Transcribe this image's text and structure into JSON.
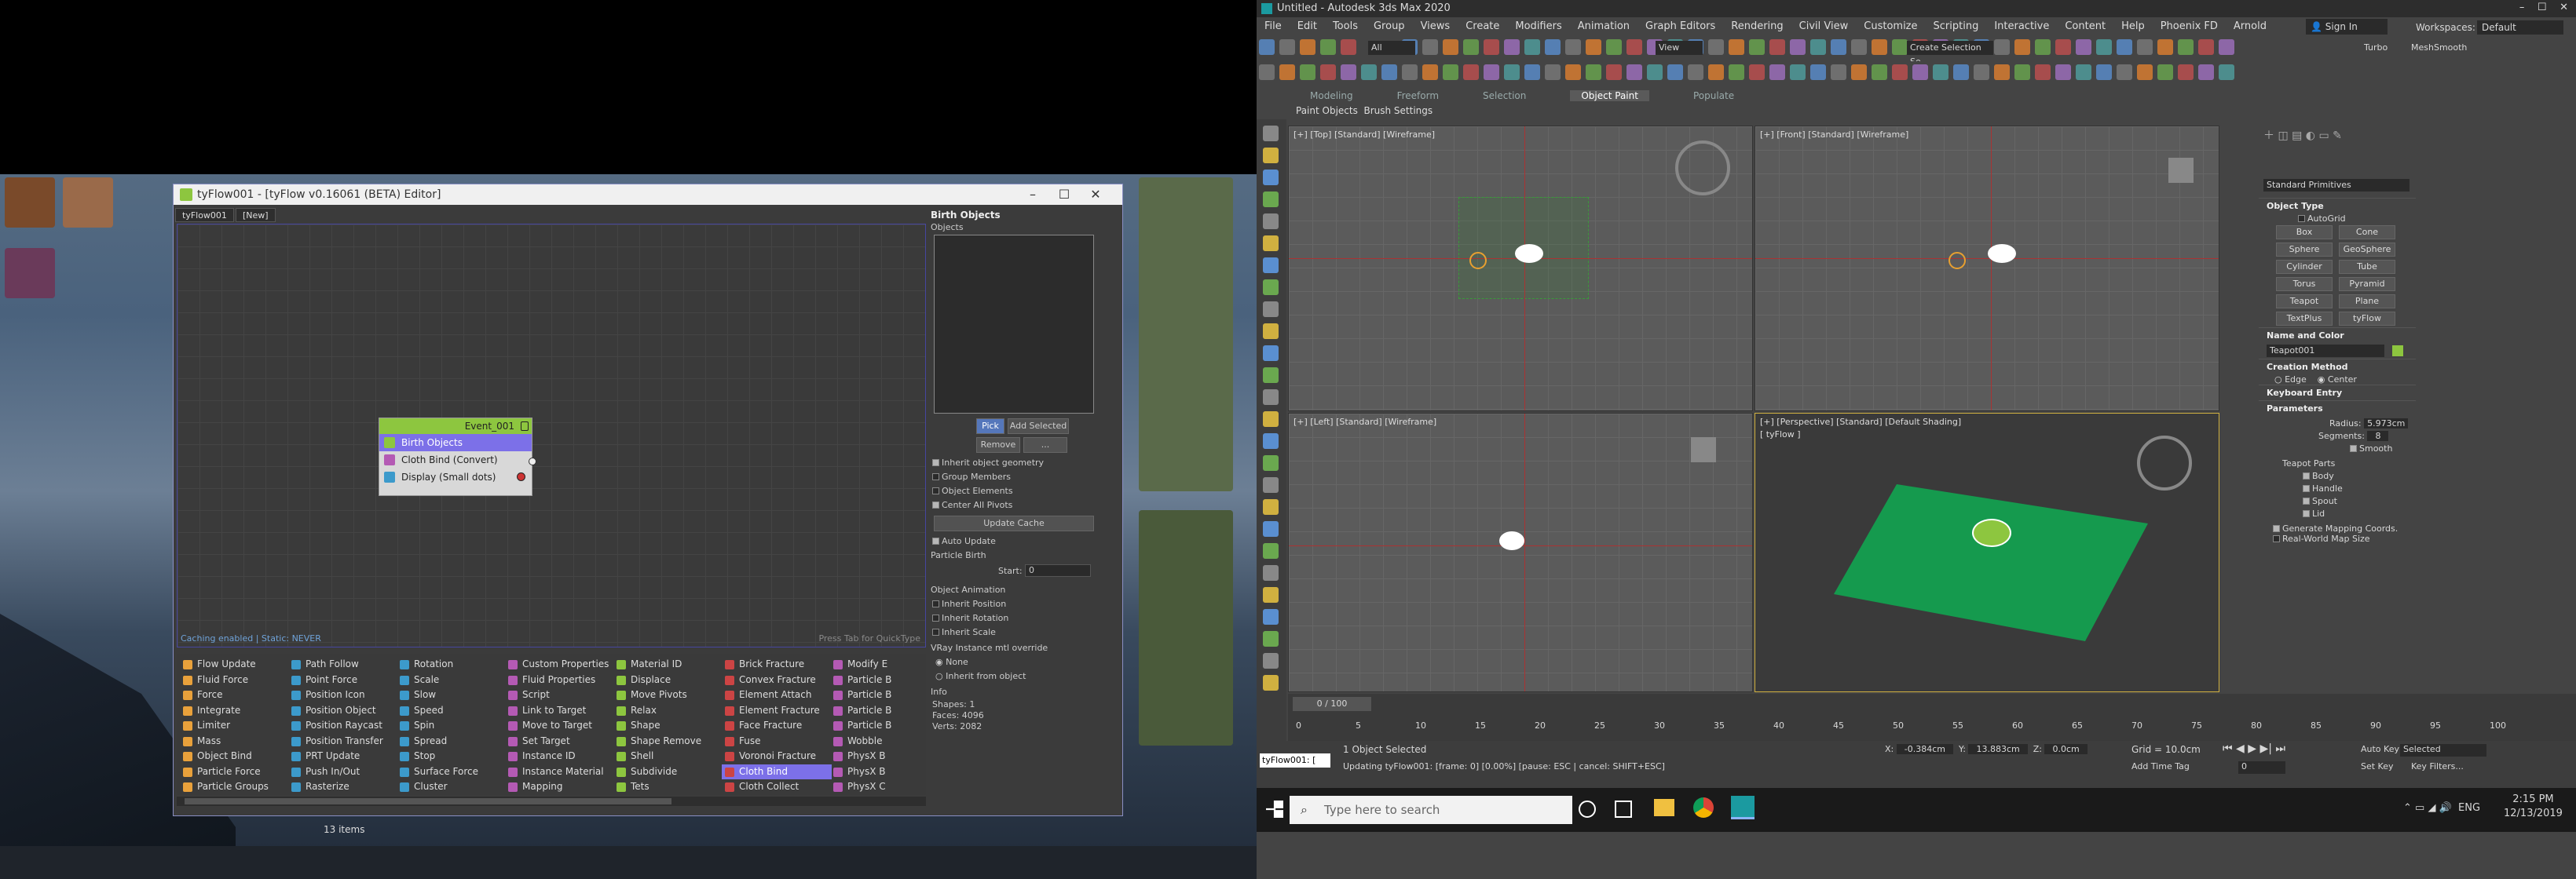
{
  "tyflow": {
    "title": "tyFlow001 - [tyFlow v0.16061 (BETA) Editor]",
    "tabs": [
      "tyFlow001",
      "[New]"
    ],
    "graph_status_left": "Caching enabled | Static: NEVER",
    "graph_status_right": "Press Tab for QuickType",
    "event_node": {
      "title": "Event_001",
      "ops": [
        "Birth Objects",
        "Cloth Bind (Convert)",
        "Display (Small dots)"
      ]
    },
    "props": {
      "rollout": "Birth Objects",
      "objects_label": "Objects",
      "pick": "Pick",
      "add_selected": "Add Selected",
      "remove": "Remove",
      "more": "...",
      "checks": [
        "Inherit object geometry",
        "Group Members",
        "Object Elements",
        "Center All Pivots"
      ],
      "update_cache": "Update Cache",
      "auto_update": "Auto Update",
      "particle_birth": "Particle Birth",
      "start_label": "Start:",
      "start_value": "0",
      "object_animation": "Object Animation",
      "anim_checks": [
        "Inherit Position",
        "Inherit Rotation",
        "Inherit Scale"
      ],
      "vray_label": "VRay Instance mtl override",
      "vray_none": "None",
      "vray_inherit": "Inherit from object",
      "info": "Info",
      "shapes": "Shapes: 1",
      "faces": "Faces: 4096",
      "verts": "Verts: 2082"
    },
    "ops_columns": [
      [
        "Flow Update",
        "Fluid Force",
        "Force",
        "Integrate",
        "Limiter",
        "Mass",
        "Object Bind",
        "Particle Force",
        "Particle Groups"
      ],
      [
        "Path Follow",
        "Point Force",
        "Position Icon",
        "Position Object",
        "Position Raycast",
        "Position Transfer",
        "PRT Update",
        "Push In/Out",
        "Rasterize"
      ],
      [
        "Rotation",
        "Scale",
        "Slow",
        "Speed",
        "Spin",
        "Spread",
        "Stop",
        "Surface Force",
        "Cluster"
      ],
      [
        "Custom Properties",
        "Fluid Properties",
        "Script",
        "Link to Target",
        "Move to Target",
        "Set Target",
        "Instance ID",
        "Instance Material",
        "Mapping"
      ],
      [
        "Material ID",
        "Displace",
        "Move Pivots",
        "Relax",
        "Shape",
        "Shape Remove",
        "Shell",
        "Subdivide",
        "Tets"
      ],
      [
        "Brick Fracture",
        "Convex Fracture",
        "Element Attach",
        "Element Fracture",
        "Face Fracture",
        "Fuse",
        "Voronoi Fracture",
        "Cloth Bind",
        "Cloth Collect"
      ],
      [
        "Modify E",
        "Particle B",
        "Particle B",
        "Particle B",
        "Particle B",
        "Wobble",
        "PhysX B",
        "PhysX B",
        "PhysX C"
      ]
    ],
    "highlighted_op": "Cloth Bind",
    "explorer_count": "13 items"
  },
  "max": {
    "title": "Untitled - Autodesk 3ds Max 2020",
    "menu": [
      "File",
      "Edit",
      "Tools",
      "Group",
      "Views",
      "Create",
      "Modifiers",
      "Animation",
      "Graph Editors",
      "Rendering",
      "Civil View",
      "Customize",
      "Scripting",
      "Interactive",
      "Content",
      "Help",
      "Phoenix FD",
      "Arnold"
    ],
    "sign_in": "Sign In",
    "workspaces_label": "Workspaces:",
    "workspaces_value": "Default",
    "view_dropdown": "View",
    "all_dropdown": "All",
    "create_selection": "Create Selection Se",
    "turbo": "Turbo",
    "meshsmooth": "MeshSmooth",
    "ribbon_tabs": [
      "Modeling",
      "Freeform",
      "Selection",
      "Object Paint",
      "Populate"
    ],
    "ribbon_selected": "Object Paint",
    "subtabs": [
      "Paint Objects",
      "Brush Settings"
    ],
    "viewports": [
      {
        "label": "[+] [Top] [Standard] [Wireframe]"
      },
      {
        "label": "[+] [Front] [Standard] [Wireframe]"
      },
      {
        "label": "[+] [Left] [Standard] [Wireframe]"
      },
      {
        "label": "[+] [Perspective] [Standard] [Default Shading]",
        "sub": "[ tyFlow ]"
      }
    ],
    "command_panel": {
      "primitives": "Standard Primitives",
      "object_type": "Object Type",
      "autogrid": "AutoGrid",
      "buttons": [
        "Box",
        "Cone",
        "Sphere",
        "GeoSphere",
        "Cylinder",
        "Tube",
        "Torus",
        "Pyramid",
        "Teapot",
        "Plane",
        "TextPlus",
        "tyFlow"
      ],
      "name_color": "Name and Color",
      "object_name": "Teapot001",
      "creation_method": "Creation Method",
      "edge": "Edge",
      "center": "Center",
      "keyboard_entry": "Keyboard Entry",
      "parameters": "Parameters",
      "radius_label": "Radius:",
      "radius_value": "5.973cm",
      "segments_label": "Segments:",
      "segments_value": "8",
      "smooth": "Smooth",
      "teapot_parts": "Teapot Parts",
      "parts": [
        "Body",
        "Handle",
        "Spout",
        "Lid"
      ],
      "gen_mapping": "Generate Mapping Coords.",
      "real_world": "Real-World Map Size"
    },
    "time_slider": "0 / 100",
    "ticks": [
      "0",
      "5",
      "10",
      "15",
      "20",
      "25",
      "30",
      "35",
      "40",
      "45",
      "50",
      "55",
      "60",
      "65",
      "70",
      "75",
      "80",
      "85",
      "90",
      "95",
      "100"
    ],
    "status": {
      "script_box": "tyFlow001: [",
      "selected": "1 Object Selected",
      "updating": "Updating tyFlow001: [frame: 0] [0.00%] [pause: ESC | cancel: SHIFT+ESC]",
      "x_label": "X:",
      "x_value": "-0.384cm",
      "y_label": "Y:",
      "y_value": "13.883cm",
      "z_label": "Z:",
      "z_value": "0.0cm",
      "grid": "Grid = 10.0cm",
      "add_time_tag": "Add Time Tag",
      "auto_key": "Auto Key",
      "set_key": "Set Key",
      "selected_dropdown": "Selected",
      "key_filters": "Key Filters...",
      "frame": "0"
    },
    "taskbar": {
      "search": "Type here to search",
      "lang": "ENG",
      "time": "2:15 PM",
      "date": "12/13/2019"
    }
  },
  "colors": {
    "accent_purple": "#7c70e8",
    "node_green": "#8dc63f",
    "max_blue": "#3c7fd0"
  }
}
